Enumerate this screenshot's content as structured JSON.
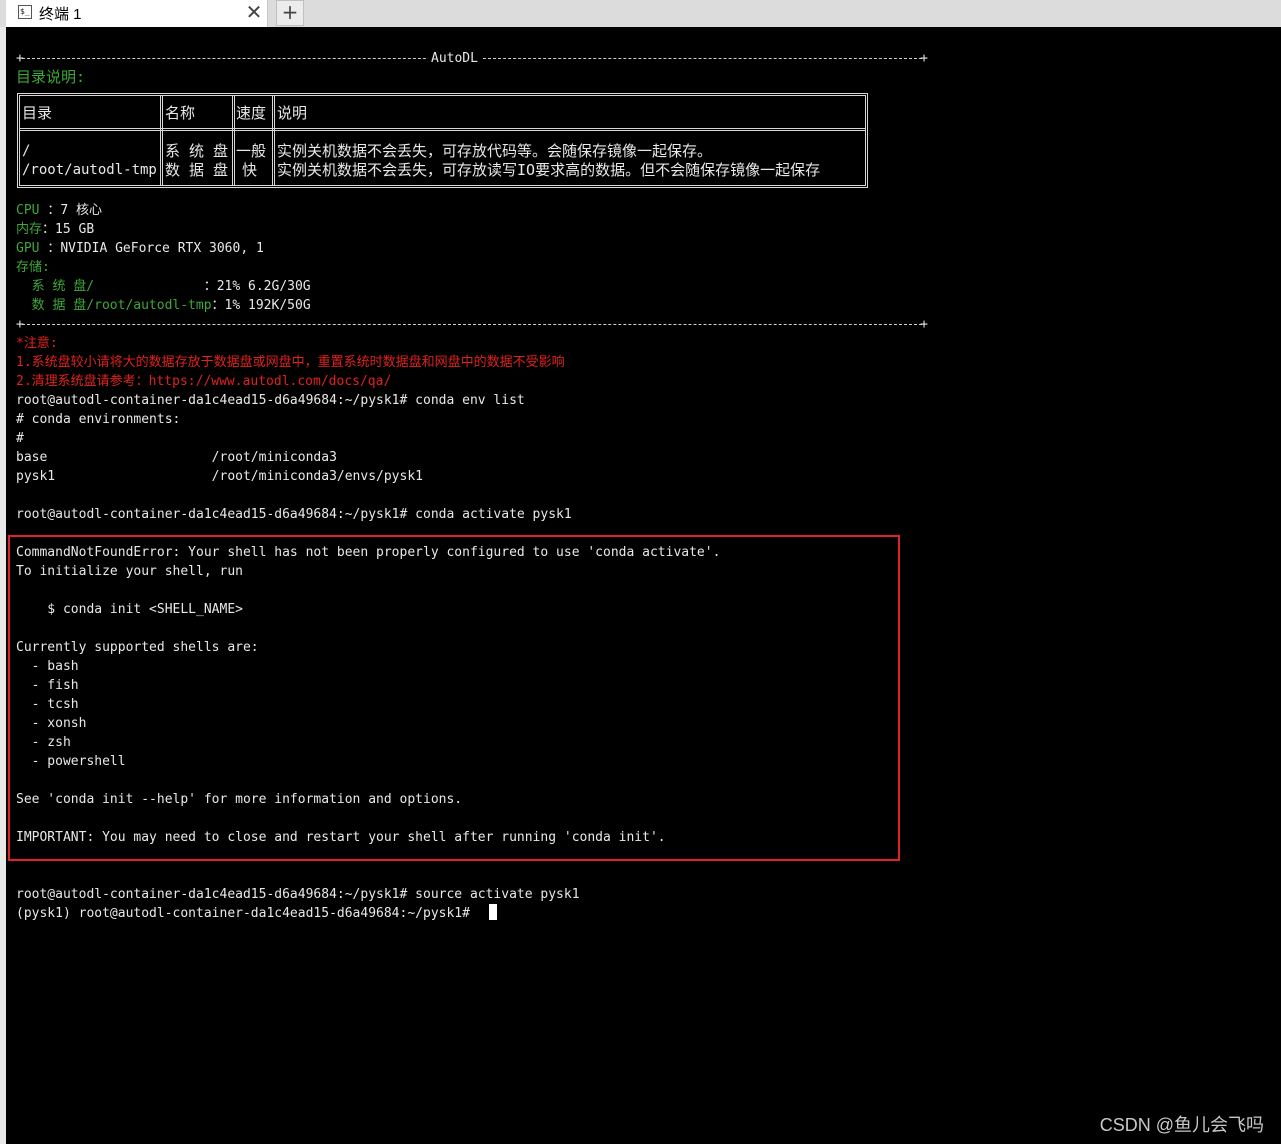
{
  "tab": {
    "title": "终端 1",
    "close": "✕",
    "new": "+",
    "icon": "terminal-icon"
  },
  "banner": {
    "title": "AutoDL",
    "dir_heading": "目录说明:",
    "table": {
      "headers": [
        "目录",
        "名称",
        "速度",
        "说明"
      ],
      "rows": [
        [
          "/",
          "系 统 盘",
          "一般",
          "实例关机数据不会丢失，可存放代码等。会随保存镜像一起保存。"
        ],
        [
          "/root/autodl-tmp",
          "数 据 盘",
          "快",
          "实例关机数据不会丢失，可存放读写IO要求高的数据。但不会随保存镜像一起保存"
        ]
      ]
    },
    "specs": [
      {
        "label": "CPU ",
        "value": "：7 核心"
      },
      {
        "label": "内存",
        "value": "：15 GB"
      },
      {
        "label": "GPU ",
        "value": "：NVIDIA GeForce RTX 3060, 1"
      }
    ],
    "storage_label": "存储:",
    "storage": [
      {
        "label": "  系 统 盘/              ",
        "value": "：21% 6.2G/30G"
      },
      {
        "label": "  数 据 盘/root/autodl-tmp",
        "value": "：1% 192K/50G"
      }
    ],
    "notice": [
      "*注意:",
      "1.系统盘较小请将大的数据存放于数据盘或网盘中，重置系统时数据盘和网盘中的数据不受影响",
      "2.清理系统盘请参考：https://www.autodl.com/docs/qa/"
    ]
  },
  "terminal_lines": [
    "root@autodl-container-da1c4ead15-d6a49684:~/pysk1# conda env list",
    "# conda environments:",
    "#",
    "base                     /root/miniconda3",
    "pysk1                    /root/miniconda3/envs/pysk1",
    "",
    "root@autodl-container-da1c4ead15-d6a49684:~/pysk1# conda activate pysk1",
    "",
    "CommandNotFoundError: Your shell has not been properly configured to use 'conda activate'.",
    "To initialize your shell, run",
    "",
    "    $ conda init <SHELL_NAME>",
    "",
    "Currently supported shells are:",
    "  - bash",
    "  - fish",
    "  - tcsh",
    "  - xonsh",
    "  - zsh",
    "  - powershell",
    "",
    "See 'conda init --help' for more information and options.",
    "",
    "IMPORTANT: You may need to close and restart your shell after running 'conda init'.",
    "",
    "",
    "root@autodl-container-da1c4ead15-d6a49684:~/pysk1# source activate pysk1",
    "(pysk1) root@autodl-container-da1c4ead15-d6a49684:~/pysk1# "
  ],
  "watermark": "CSDN @鱼儿会飞吗",
  "colors": {
    "green": "#3ea838",
    "red": "#e0211d",
    "highlight": "#e0212a"
  }
}
